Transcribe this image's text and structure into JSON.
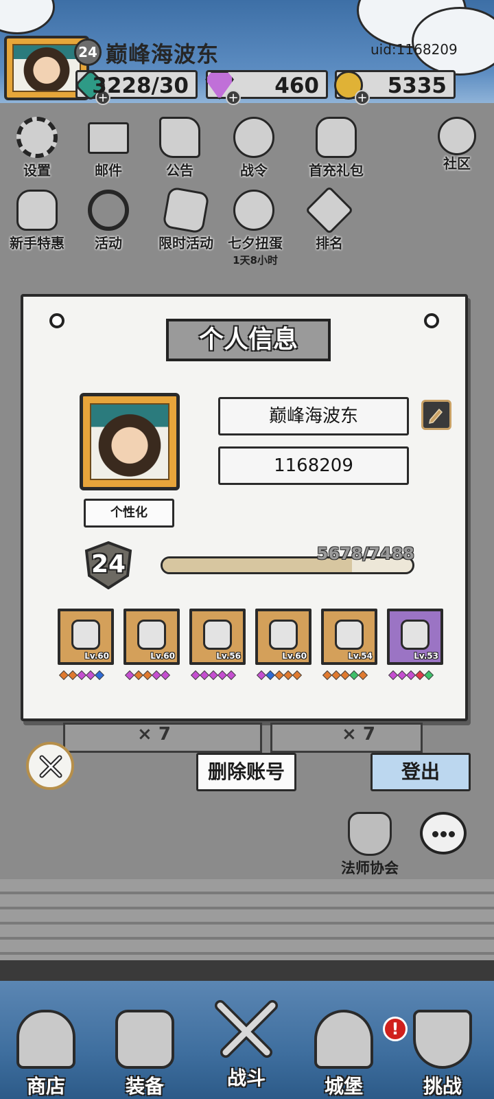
{
  "player": {
    "name": "巅峰海波东",
    "level": "24",
    "uid": "uid:1168209"
  },
  "resources": {
    "energy": "3228/30",
    "gems": "460",
    "gold": "5335",
    "plus_symbol": "+"
  },
  "menu": {
    "row1": [
      {
        "label": "设置"
      },
      {
        "label": "邮件"
      },
      {
        "label": "公告"
      },
      {
        "label": "战令"
      },
      {
        "label": "首充礼包"
      },
      {
        "label": "社区"
      }
    ],
    "row2": [
      {
        "label": "新手特惠"
      },
      {
        "label": "活动"
      },
      {
        "label": "限时活动"
      },
      {
        "label": "七夕扭蛋",
        "sub": "1天8小时"
      },
      {
        "label": "排名"
      }
    ]
  },
  "dialog": {
    "title": "个人信息",
    "name_value": "巅峰海波东",
    "id_value": "1168209",
    "customize_label": "个性化",
    "level": "24",
    "exp_text": "5678/7488",
    "exp_ratio": 0.758,
    "equipment": [
      {
        "level": "Lv.60",
        "rarity": "orange",
        "icon": "helmet-icon",
        "gems": [
          "#e07a2f",
          "#e07a2f",
          "#c54fd0",
          "#c54fd0",
          "#2e6bd6"
        ]
      },
      {
        "level": "Lv.60",
        "rarity": "orange",
        "icon": "armor-icon",
        "gems": [
          "#c54fd0",
          "#e07a2f",
          "#e07a2f",
          "#c54fd0",
          "#c54fd0"
        ]
      },
      {
        "level": "Lv.56",
        "rarity": "orange",
        "icon": "boots-icon",
        "gems": [
          "#c54fd0",
          "#c54fd0",
          "#c54fd0",
          "#c54fd0",
          "#c54fd0"
        ]
      },
      {
        "level": "Lv.60",
        "rarity": "orange",
        "icon": "bracer-icon",
        "gems": [
          "#c54fd0",
          "#2e6bd6",
          "#e07a2f",
          "#e07a2f",
          "#e07a2f"
        ]
      },
      {
        "level": "Lv.54",
        "rarity": "orange",
        "icon": "ring-icon",
        "gems": [
          "#e07a2f",
          "#e07a2f",
          "#e07a2f",
          "#3fc06a",
          "#e07a2f"
        ]
      },
      {
        "level": "Lv.53",
        "rarity": "purple",
        "icon": "amulet-icon",
        "gems": [
          "#c54fd0",
          "#c54fd0",
          "#c54fd0",
          "#e03a4a",
          "#3fc06a"
        ]
      }
    ],
    "delete_label": "删除账号",
    "logout_label": "登出"
  },
  "rewards": {
    "left_count": "× 7",
    "right_count": "× 7"
  },
  "side": {
    "guild_label": "法师协会"
  },
  "bottom_nav": [
    {
      "label": "商店"
    },
    {
      "label": "装备"
    },
    {
      "label": "战斗"
    },
    {
      "label": "城堡"
    },
    {
      "label": "挑战"
    }
  ],
  "alert_mark": "!",
  "colors": {
    "energy_gem": "#2e9a86",
    "diamond": "#c070d8",
    "gold": "#e0b236",
    "logout_button": "#bcd7ef"
  }
}
